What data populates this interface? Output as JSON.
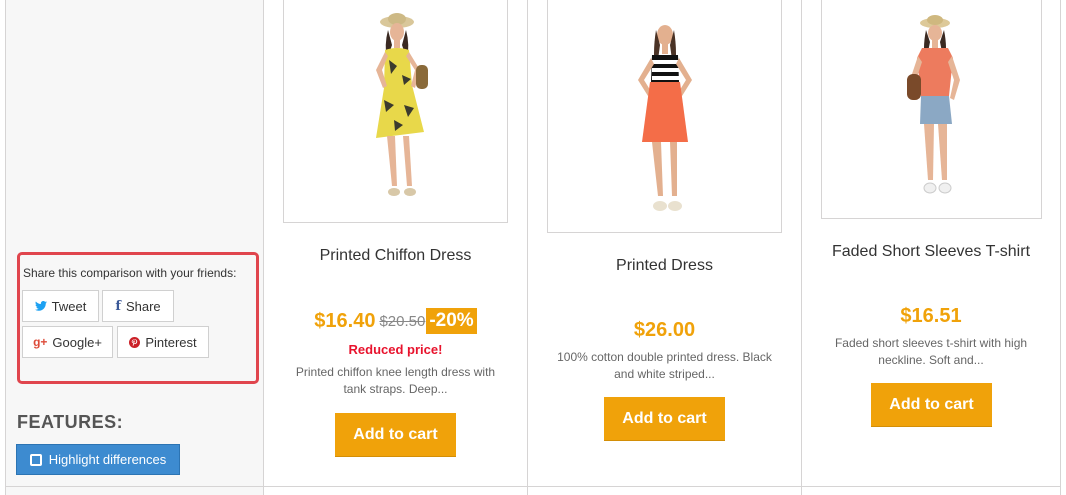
{
  "share": {
    "title": "Share this comparison with your friends:",
    "tweet": "Tweet",
    "share": "Share",
    "google": "Google+",
    "pinterest": "Pinterest"
  },
  "features": {
    "title": "FEATURES:",
    "highlight": "Highlight differences"
  },
  "products": [
    {
      "name": "Printed Chiffon Dress",
      "price": "$16.40",
      "old_price": "$20.50",
      "discount": "-20%",
      "reduced": "Reduced price!",
      "desc_line1": "Printed chiffon knee length dress with",
      "desc_line2": "tank straps. Deep...",
      "cart": "Add to cart"
    },
    {
      "name": "Printed Dress",
      "price": "$26.00",
      "desc_line1": "100% cotton double printed dress. Black",
      "desc_line2": "and white striped...",
      "cart": "Add to cart"
    },
    {
      "name": "Faded Short Sleeves T-shirt",
      "price": "$16.51",
      "desc_line1": "Faded short sleeves t-shirt with high",
      "desc_line2": "neckline. Soft and...",
      "cart": "Add to cart"
    }
  ],
  "colors": {
    "accent": "#f0a20a",
    "reduced": "#e8132d",
    "highlight_button": "#3d8bd0",
    "share_frame": "#e0454d"
  }
}
